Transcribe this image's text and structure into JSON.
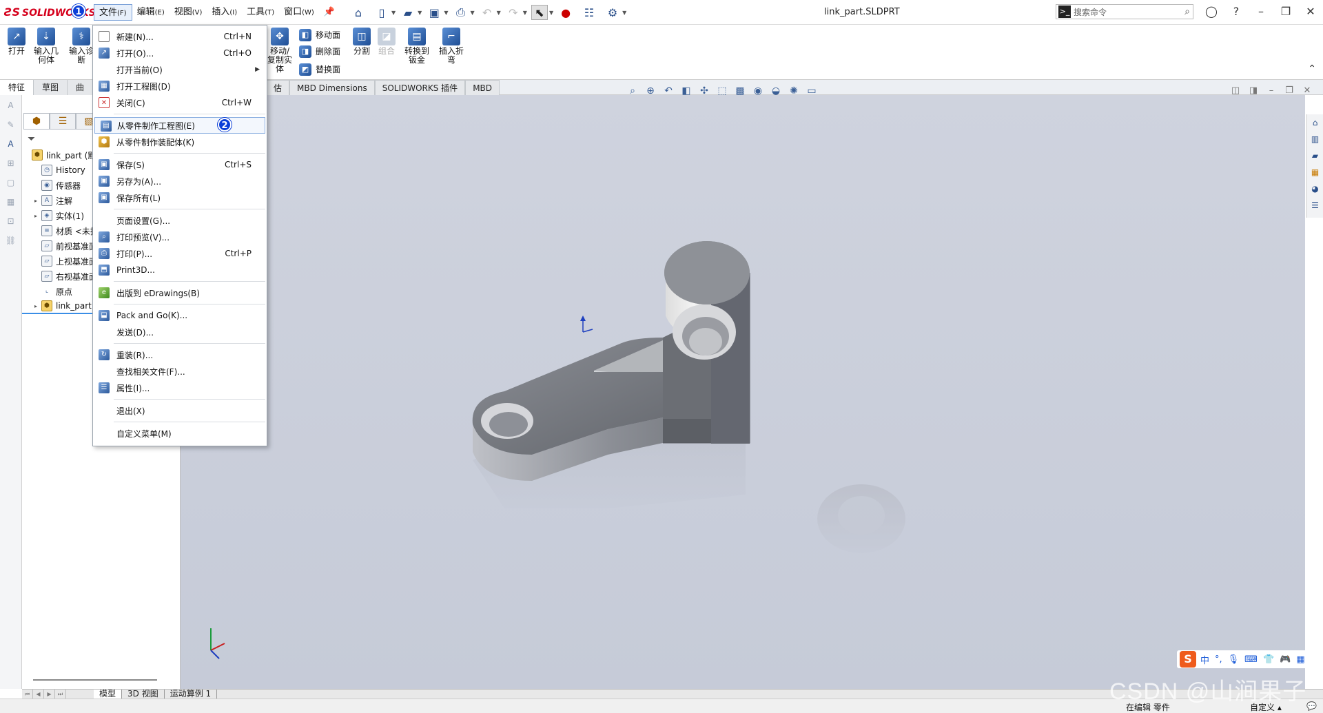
{
  "app": {
    "logo_text": "SOLIDWORKS",
    "document_title": "link_part.SLDPRT"
  },
  "menubar": [
    {
      "label": "文件",
      "key": "(F)"
    },
    {
      "label": "编辑",
      "key": "(E)"
    },
    {
      "label": "视图",
      "key": "(V)"
    },
    {
      "label": "插入",
      "key": "(I)"
    },
    {
      "label": "工具",
      "key": "(T)"
    },
    {
      "label": "窗口",
      "key": "(W)"
    }
  ],
  "search": {
    "placeholder": "搜索命令"
  },
  "badges": {
    "one": "1",
    "two": "2"
  },
  "ribbon": {
    "open": "打开",
    "import_geometry": "输入几何体",
    "import_diag": "输入诊断",
    "move_copy": "移动/复制实体",
    "move_face": "移动面",
    "delete_face": "删除面",
    "replace_face": "替换面",
    "split": "分割",
    "combine": "组合",
    "convert_sheet": "转换到钣金",
    "insert_bend": "插入折弯"
  },
  "command_tabs": {
    "left": [
      "特征",
      "草图",
      "曲"
    ],
    "right": [
      "估",
      "MBD Dimensions",
      "SOLIDWORKS 插件",
      "MBD"
    ]
  },
  "file_menu": {
    "new": {
      "label": "新建(N)...",
      "shortcut": "Ctrl+N"
    },
    "open": {
      "label": "打开(O)...",
      "shortcut": "Ctrl+O"
    },
    "open_current": {
      "label": "打开当前(O)"
    },
    "open_drawing": {
      "label": "打开工程图(D)"
    },
    "close": {
      "label": "关闭(C)",
      "shortcut": "Ctrl+W"
    },
    "make_drawing": {
      "label": "从零件制作工程图(E)"
    },
    "make_assembly": {
      "label": "从零件制作装配体(K)"
    },
    "save": {
      "label": "保存(S)",
      "shortcut": "Ctrl+S"
    },
    "save_as": {
      "label": "另存为(A)..."
    },
    "save_all": {
      "label": "保存所有(L)"
    },
    "page_setup": {
      "label": "页面设置(G)..."
    },
    "print_preview": {
      "label": "打印预览(V)..."
    },
    "print": {
      "label": "打印(P)...",
      "shortcut": "Ctrl+P"
    },
    "print3d": {
      "label": "Print3D..."
    },
    "publish": {
      "label": "出版到 eDrawings(B)"
    },
    "pack_go": {
      "label": "Pack and Go(K)..."
    },
    "send": {
      "label": "发送(D)..."
    },
    "reload": {
      "label": "重装(R)..."
    },
    "find_refs": {
      "label": "查找相关文件(F)..."
    },
    "properties": {
      "label": "属性(I)..."
    },
    "exit": {
      "label": "退出(X)"
    },
    "customize": {
      "label": "自定义菜单(M)"
    }
  },
  "tree": [
    {
      "label": "link_part (默认",
      "icon": "part-icon",
      "expand": ""
    },
    {
      "label": "History",
      "icon": "history-icon",
      "expand": ""
    },
    {
      "label": "传感器",
      "icon": "sensor-icon",
      "expand": ""
    },
    {
      "label": "注解",
      "icon": "annotation-icon",
      "expand": "▸"
    },
    {
      "label": "实体(1)",
      "icon": "solid-body-icon",
      "expand": "▸"
    },
    {
      "label": "材质 <未指",
      "icon": "material-icon",
      "expand": ""
    },
    {
      "label": "前视基准面",
      "icon": "plane-icon",
      "expand": ""
    },
    {
      "label": "上视基准面",
      "icon": "plane-icon",
      "expand": ""
    },
    {
      "label": "右视基准面",
      "icon": "plane-icon",
      "expand": ""
    },
    {
      "label": "原点",
      "icon": "origin-icon",
      "expand": ""
    },
    {
      "label": "link_part.",
      "icon": "part-icon",
      "expand": "▸"
    }
  ],
  "bottom_tabs": [
    "模型",
    "3D 视图",
    "运动算例 1"
  ],
  "status": {
    "editing": "在编辑 零件",
    "custom": "自定义"
  },
  "ime": {
    "cn": "中",
    "punct": "°,"
  },
  "watermark": "CSDN @山涧果子",
  "colors": {
    "accent": "#0b3fd8",
    "logo": "#d5001c",
    "viewport": "#c8ccd8"
  }
}
